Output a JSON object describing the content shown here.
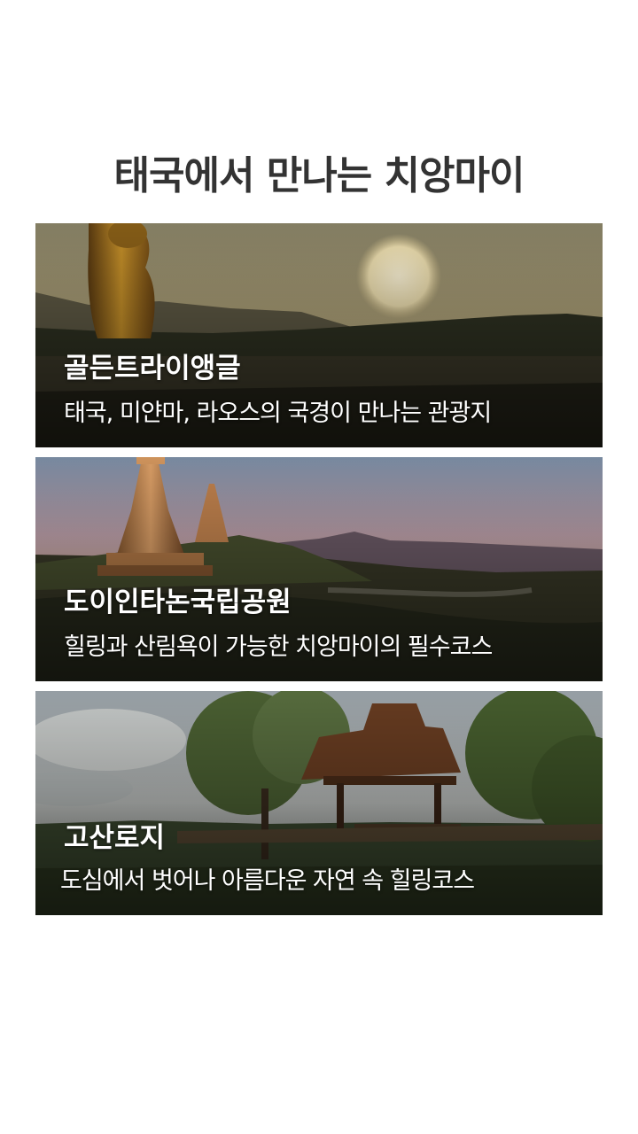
{
  "page": {
    "title": "태국에서 만나는 치앙마이"
  },
  "cards": [
    {
      "title": "골든트라이앵글",
      "description": "태국, 미얀마, 라오스의 국경이 만나는 관광지",
      "image": "golden-triangle-sunset-photo"
    },
    {
      "title": "도이인타논국립공원",
      "description": "힐링과 산림욕이 가능한 치앙마이의 필수코스",
      "image": "doi-inthanon-pagodas-photo"
    },
    {
      "title": "고산로지",
      "description": "도심에서 벗어나 아름다운 자연 속 힐링코스",
      "image": "mountain-lodge-photo"
    }
  ]
}
